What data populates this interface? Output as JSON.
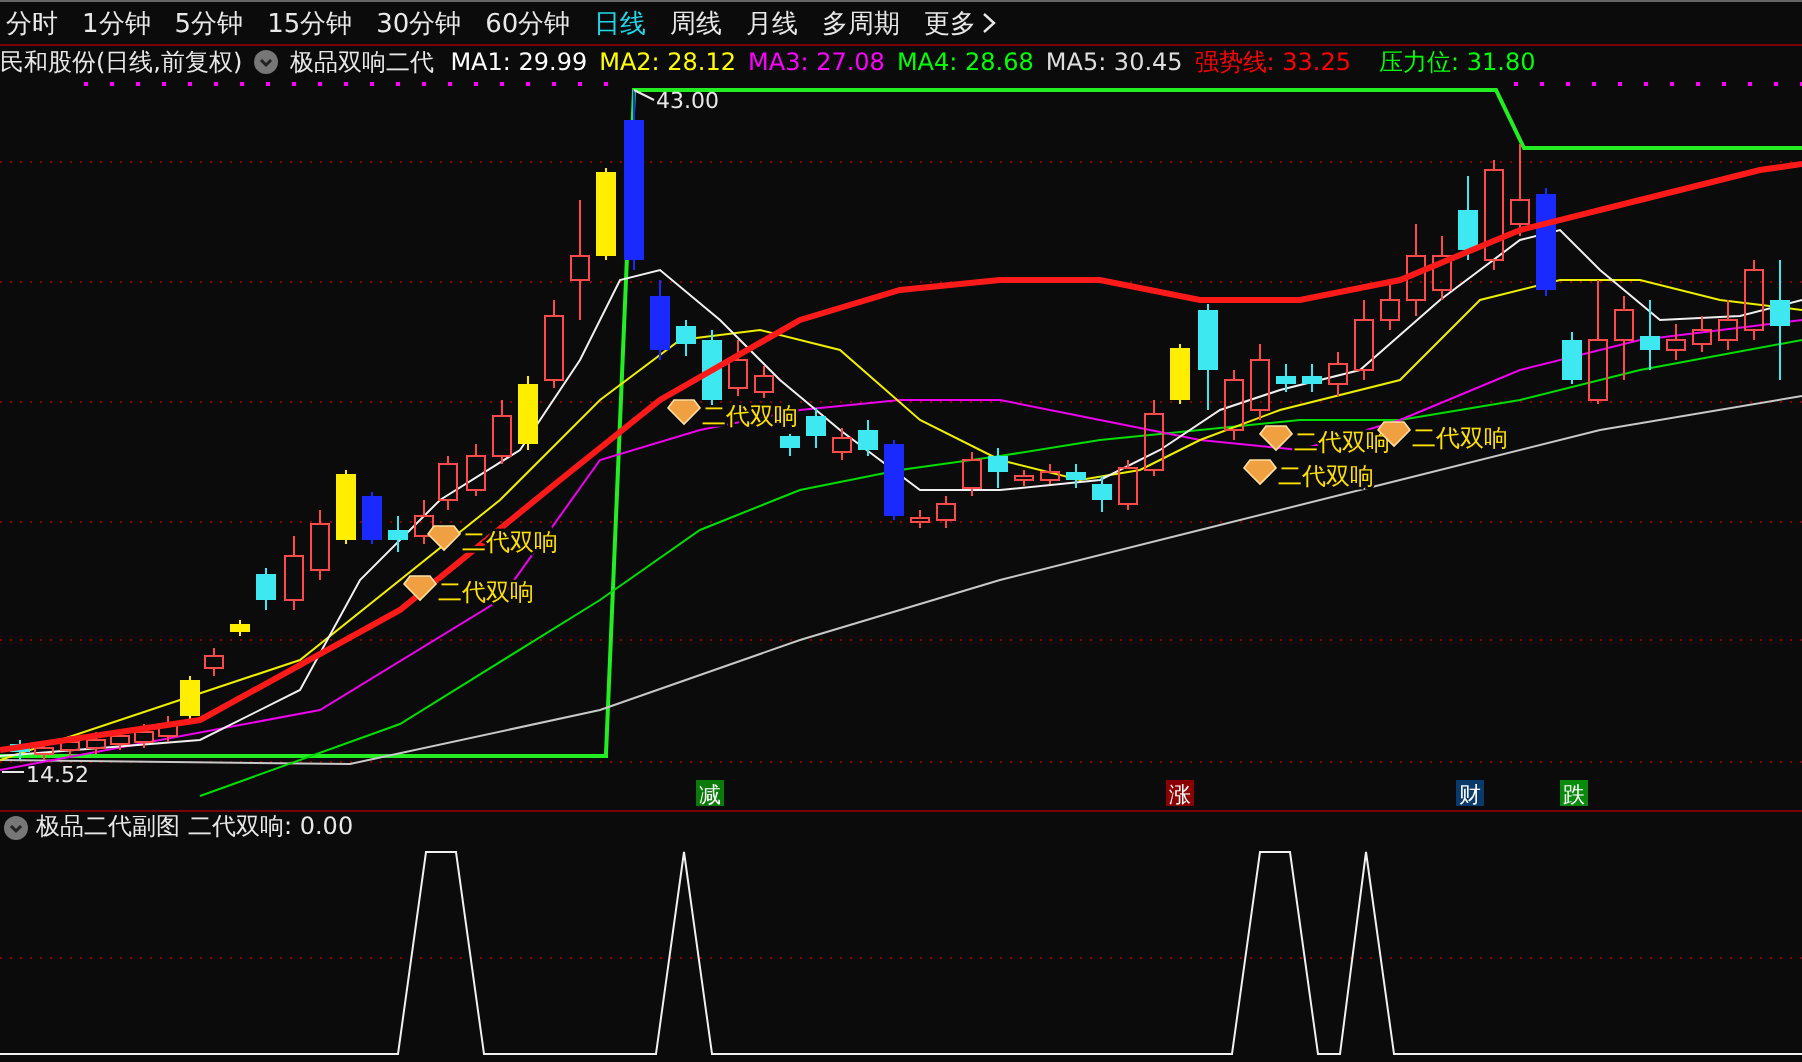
{
  "toolbar": {
    "periods": [
      {
        "label": "分时",
        "selected": false
      },
      {
        "label": "1分钟",
        "selected": false
      },
      {
        "label": "5分钟",
        "selected": false
      },
      {
        "label": "15分钟",
        "selected": false
      },
      {
        "label": "30分钟",
        "selected": false
      },
      {
        "label": "60分钟",
        "selected": false
      },
      {
        "label": "日线",
        "selected": true
      },
      {
        "label": "周线",
        "selected": false
      },
      {
        "label": "月线",
        "selected": false
      },
      {
        "label": "多周期",
        "selected": false
      }
    ],
    "more": "更多"
  },
  "legend": {
    "title": "民和股份(日线,前复权)",
    "indicator": "极品双响二代",
    "items": [
      {
        "label": "MA1: 29.99",
        "color": "#ffffff"
      },
      {
        "label": "MA2: 28.12",
        "color": "#ffff00"
      },
      {
        "label": "MA3: 27.08",
        "color": "#ff00ff"
      },
      {
        "label": "MA4: 28.68",
        "color": "#00ff00"
      },
      {
        "label": "MA5: 30.45",
        "color": "#dddddd"
      },
      {
        "label": "强势线: 33.25",
        "color": "#ff0000"
      },
      {
        "label": "压力位: 31.80",
        "color": "#00ff00"
      }
    ]
  },
  "chart": {
    "high_label": "43.00",
    "low_label": "14.52",
    "signals": [
      {
        "label": "二代双响"
      },
      {
        "label": "二代双响"
      },
      {
        "label": "二代双响"
      },
      {
        "label": "二代双响"
      },
      {
        "label": "二代双响"
      },
      {
        "label": "二代双响"
      }
    ],
    "events": [
      {
        "label": "减",
        "color": "#0a7a0a"
      },
      {
        "label": "涨",
        "color": "#8a0000"
      },
      {
        "label": "财",
        "color": "#0a3a6a"
      },
      {
        "label": "跌",
        "color": "#0a8a0a"
      }
    ]
  },
  "subchart": {
    "title": "极品二代副图",
    "reading": "二代双响: 0.00"
  }
}
